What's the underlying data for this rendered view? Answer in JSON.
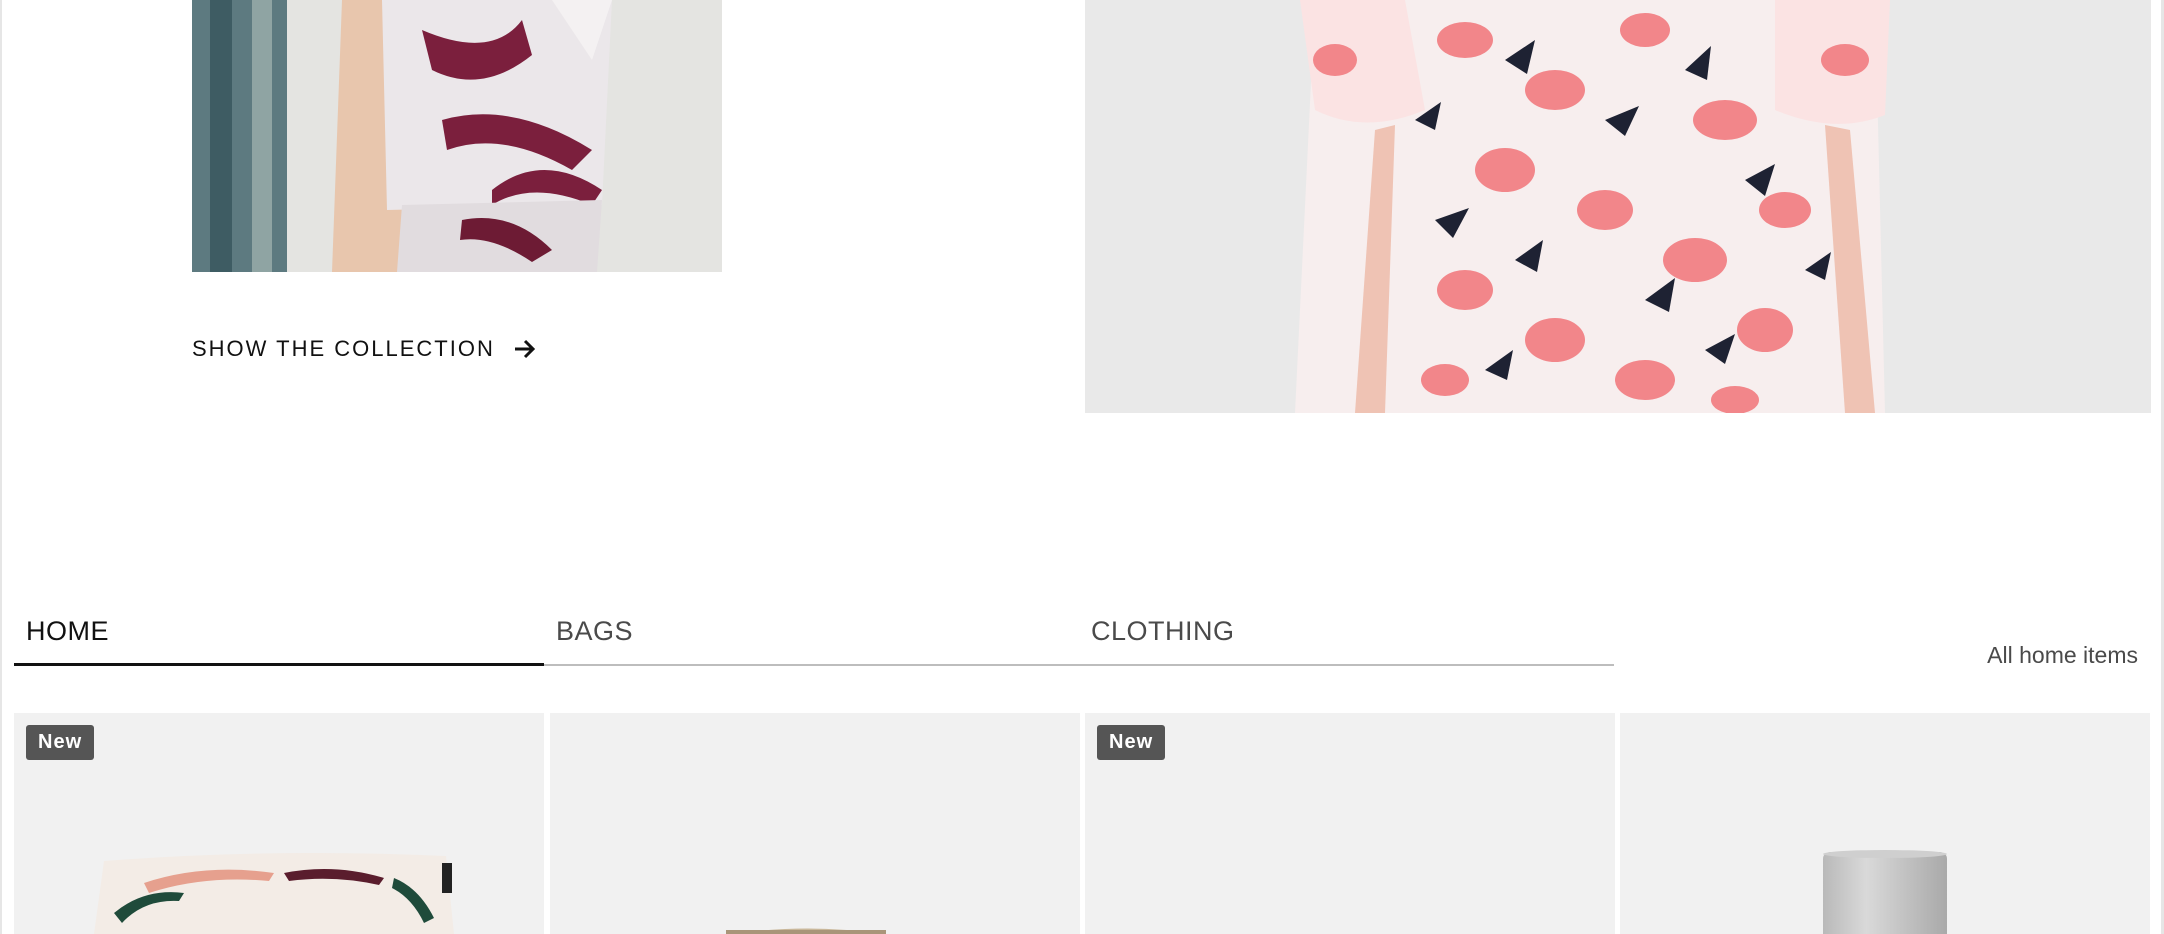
{
  "collection": {
    "cta_label": "SHOW THE COLLECTION"
  },
  "tabs": [
    {
      "label": "HOME",
      "active": true
    },
    {
      "label": "BAGS",
      "active": false
    },
    {
      "label": "CLOTHING",
      "active": false
    }
  ],
  "all_items_link": "All home items",
  "products": [
    {
      "badge": "New",
      "product": "cushion"
    },
    {
      "badge": "",
      "product": "bag"
    },
    {
      "badge": "New",
      "product": "item"
    },
    {
      "badge": "",
      "product": "vase"
    }
  ],
  "colors": {
    "badge_bg": "#555555",
    "card_bg": "#f1f1f1",
    "tab_active": "#111111",
    "tab_inactive": "#4a4a4a"
  }
}
